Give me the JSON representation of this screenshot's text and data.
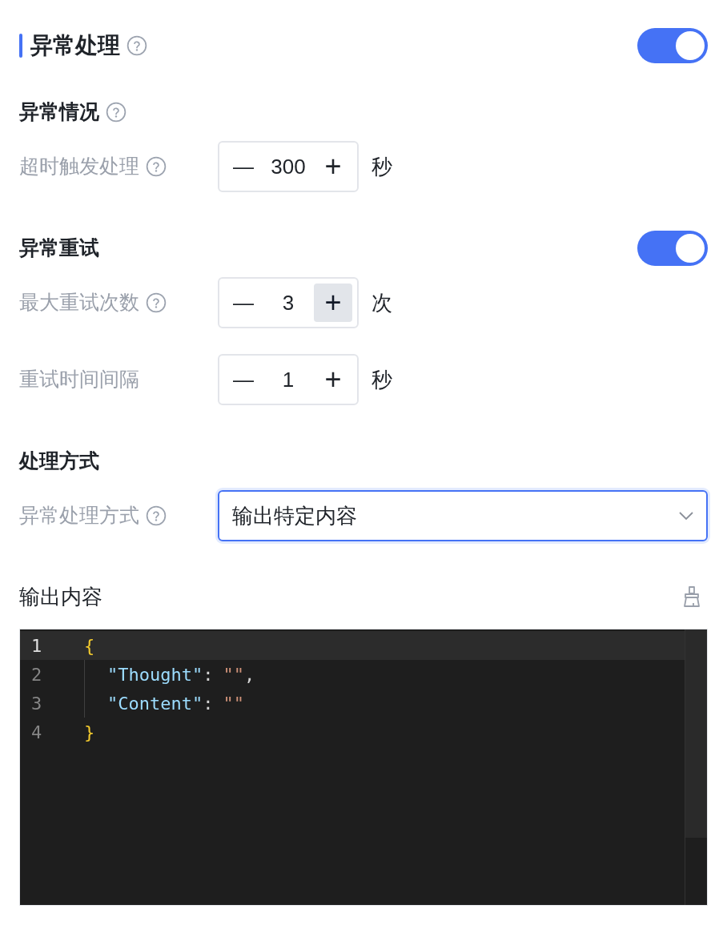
{
  "header": {
    "title": "异常处理",
    "help": true,
    "on": true
  },
  "sections": [
    {
      "title": "异常情况",
      "help": true,
      "fields": [
        {
          "kind": "stepper",
          "label": "超时触发处理",
          "help": true,
          "minus": "—",
          "value": "300",
          "plus": "+",
          "plus_hovered": false,
          "unit": "秒"
        }
      ]
    },
    {
      "title": "异常重试",
      "help": false,
      "toggle": {
        "on": true
      },
      "fields": [
        {
          "kind": "stepper",
          "label": "最大重试次数",
          "help": true,
          "minus": "—",
          "value": "3",
          "plus": "+",
          "plus_hovered": true,
          "unit": "次"
        },
        {
          "kind": "stepper",
          "label": "重试时间间隔",
          "help": false,
          "minus": "—",
          "value": "1",
          "plus": "+",
          "plus_hovered": false,
          "unit": "秒"
        }
      ]
    },
    {
      "title": "处理方式",
      "help": false,
      "fields": [
        {
          "kind": "select",
          "label": "异常处理方式",
          "help": true,
          "value": "输出特定内容",
          "focused": true
        }
      ]
    }
  ],
  "output": {
    "label": "输出内容",
    "lines": [
      {
        "number": "1",
        "selected": true,
        "indented": false,
        "tokens": [
          {
            "kind": "brace",
            "text": "{"
          }
        ]
      },
      {
        "number": "2",
        "selected": false,
        "indented": true,
        "tokens": [
          {
            "kind": "key",
            "text": "\"Thought\""
          },
          {
            "kind": "punct",
            "text": ":"
          },
          {
            "kind": "string",
            "text": "\"\""
          },
          {
            "kind": "punct",
            "text": ","
          }
        ]
      },
      {
        "number": "3",
        "selected": false,
        "indented": true,
        "tokens": [
          {
            "kind": "key",
            "text": "\"Content\""
          },
          {
            "kind": "punct",
            "text": ":"
          },
          {
            "kind": "string",
            "text": "\"\""
          }
        ]
      },
      {
        "number": "4",
        "selected": false,
        "indented": false,
        "tokens": [
          {
            "kind": "brace",
            "text": "}"
          }
        ]
      }
    ]
  }
}
